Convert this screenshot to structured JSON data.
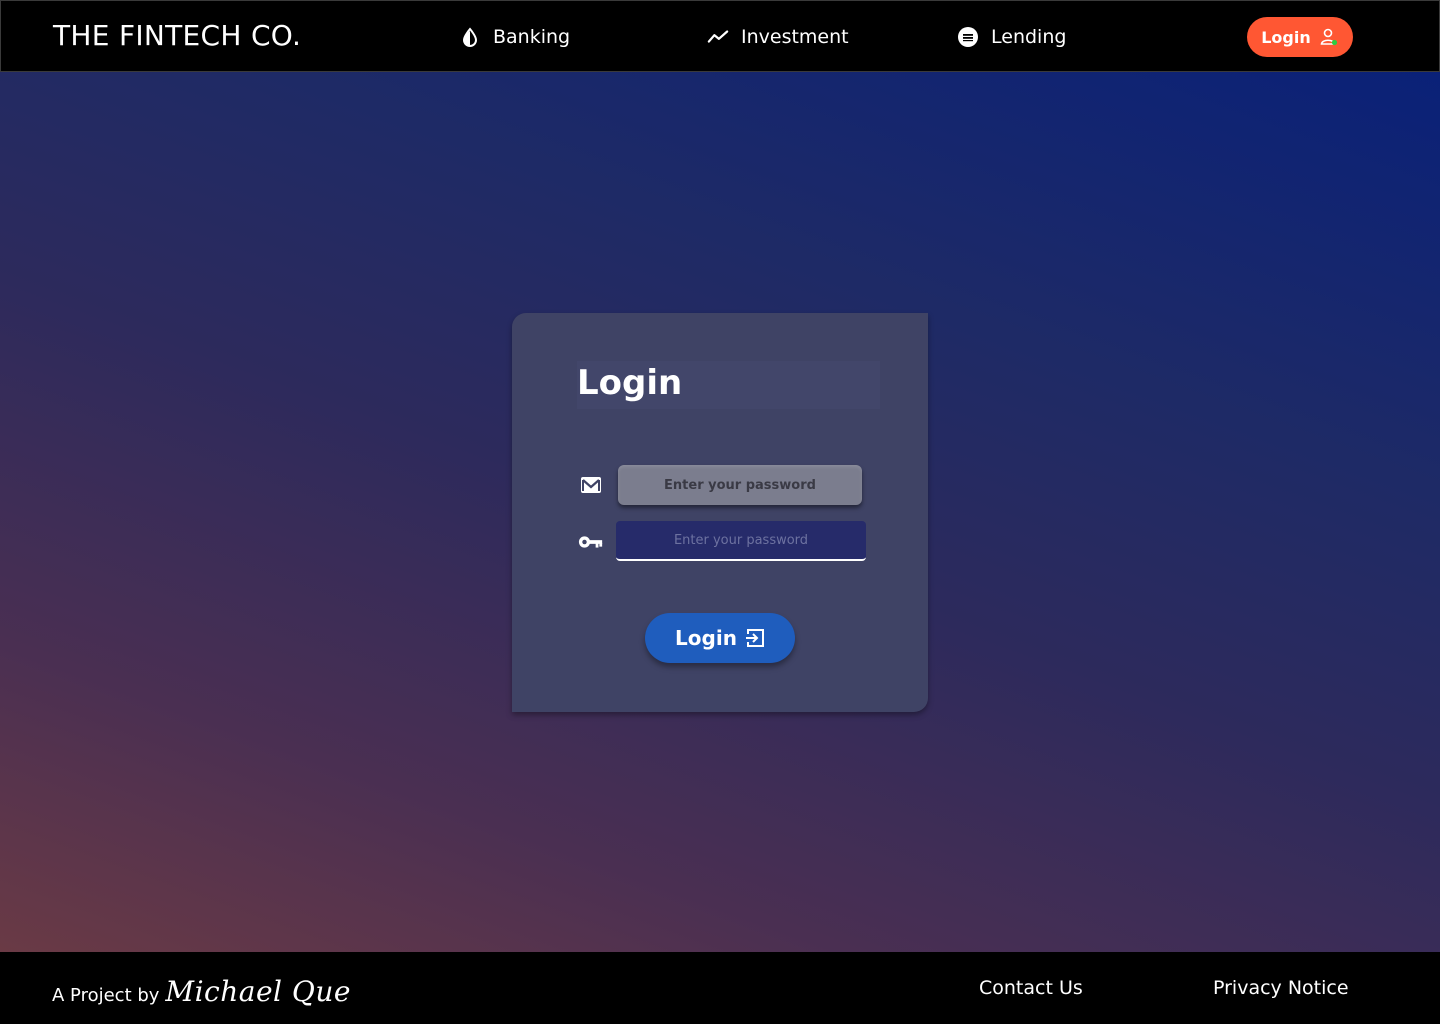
{
  "header": {
    "brand": "THE FINTECH CO.",
    "nav": [
      {
        "label": "Banking",
        "icon": "drop-icon"
      },
      {
        "label": "Investment",
        "icon": "trend-line-icon"
      },
      {
        "label": "Lending",
        "icon": "lending-icon"
      }
    ],
    "login_label": "Login",
    "login_icon": "user-icon",
    "login_color": "#ff5733"
  },
  "card": {
    "title": "Login",
    "email_placeholder": "Enter your password",
    "password_placeholder": "Enter your password",
    "login_label": "Login",
    "login_color": "#1f5dbd"
  },
  "footer": {
    "credit_prefix": "A Project by",
    "signature": "Michael Que",
    "contact_label": "Contact Us",
    "privacy_label": "Privacy Notice"
  }
}
